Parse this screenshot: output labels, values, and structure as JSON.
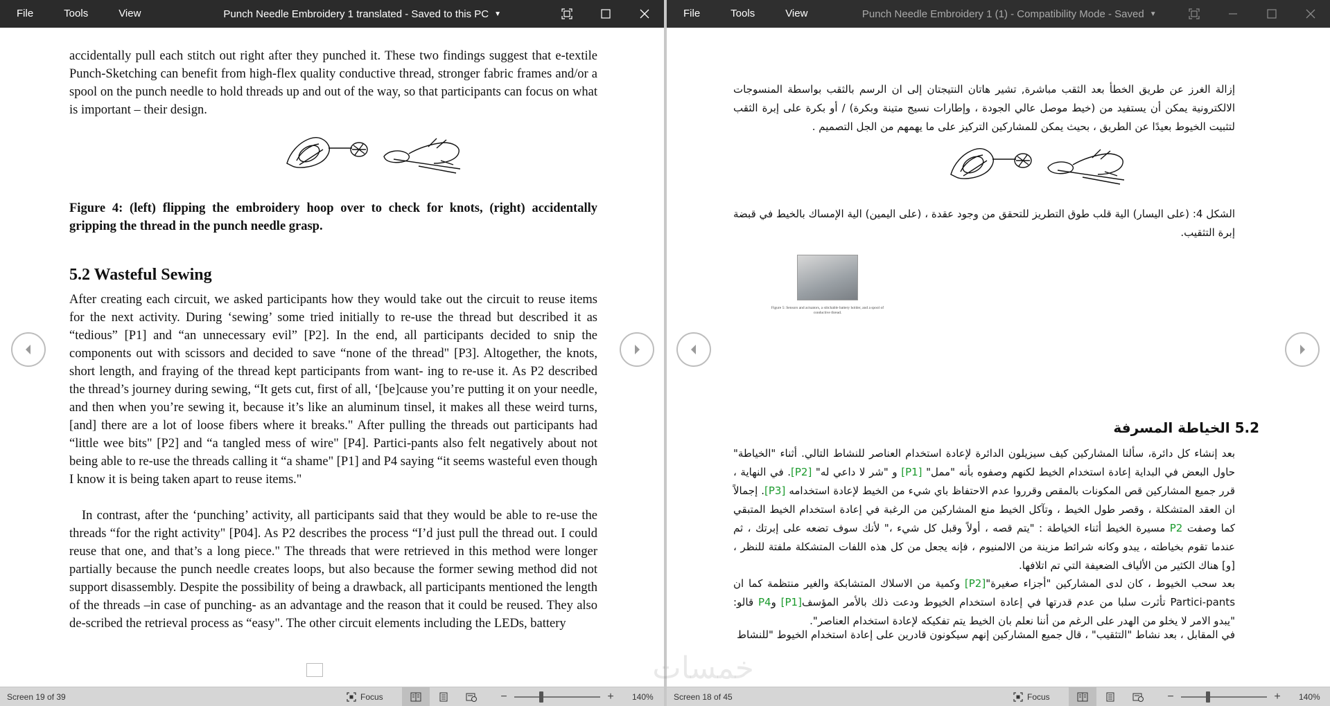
{
  "left_window": {
    "menu": [
      "File",
      "Tools",
      "View"
    ],
    "title": "Punch Needle Embroidery 1 translated  -  Saved to this PC",
    "status": {
      "screen": "Screen 19 of 39",
      "focus": "Focus",
      "zoom": "140%"
    },
    "doc": {
      "para1": "accidentally pull each stitch out right after they punched it. These two findings suggest that e-textile Punch-Sketching can benefit from high-flex quality conductive thread, stronger fabric frames and/or a spool on the punch needle to hold threads up and out of the way, so that participants can focus on what is important – their design.",
      "caption": "Figure 4: (left) flipping the embroidery hoop over to check for knots, (right) accidentally gripping the thread in the punch needle grasp.",
      "heading": "5.2 Wasteful Sewing",
      "para2": "After creating each circuit, we asked participants how they would take out the circuit to reuse items for the next activity. During ‘sewing’ some tried initially to re-use the thread but described it as “tedious” [P1] and “an unnecessary evil” [P2]. In the end, all participants decided to snip the components out with scissors and decided to save “none of the thread\" [P3]. Altogether, the knots, short length, and fraying of the thread kept participants from want- ing to re-use it. As P2 described the thread’s journey during sewing, “It gets cut, first of all, ‘[be]cause you’re putting it on your needle, and then when you’re sewing it, because it’s like an aluminum tinsel, it makes all these weird turns, [and] there are a lot of loose fibers where it breaks.\" After pulling the threads out participants had “little wee bits\" [P2] and “a tangled mess of wire\" [P4]. Partici-pants also felt negatively about not being able to re-use the threads calling it “a shame\" [P1] and P4 saying “it seems wasteful even though I know it is being taken apart to reuse items.\"",
      "para3": "In contrast, after the ‘punching’ activity, all participants said that they would be able to re-use the threads “for the right activity\" [P04]. As P2 describes the process “I’d just pull the thread out. I could reuse that one, and that’s a long piece.\" The threads that were retrieved in this method were longer partially because the punch needle creates loops, but also because the former sewing method did not support disassembly. Despite the possibility of being a drawback, all participants mentioned the length of the threads –in case of punching- as an advantage and the reason that it could be reused. They also de-scribed the retrieval process as “easy\". The other circuit elements including the LEDs, battery"
    }
  },
  "right_window": {
    "menu": [
      "File",
      "Tools",
      "View"
    ],
    "title": "Punch Needle Embroidery 1 (1)  -  Compatibility Mode  -  Saved",
    "status": {
      "screen": "Screen 18 of 45",
      "focus": "Focus",
      "zoom": "140%"
    },
    "doc": {
      "para1": "إزالة الغرز عن طريق الخطأ بعد الثقب مباشرة, تشير هاتان النتيجتان إلى ان الرسم بالثقب بواسطة المنسوجات الالكترونية يمكن أن يستفيد من (خيط موصل عالي الجودة ، وإطارات نسيج متينة وبكرة) / أو بكرة على إبرة الثقب لتثبيت الخيوط بعيدًا عن الطريق ، بحيث يمكن للمشاركين التركيز على ما يهمهم من الجل التصميم .",
      "caption": "الشكل 4: (على اليسار) الية قلب طوق التطريز للتحقق من وجود عقدة ، (على اليمين) الية الإمساك بالخيط في قبضة إبرة التثقيب.",
      "photo_caption": "Figure 5: Sensors and actuators, a stitchable battery holder, and a spool of conductive thread.",
      "heading": "5.2  الخياطة المسرفة",
      "para2_a": "بعد إنشاء كل دائرة، سألنا المشاركين كيف سيزيلون الدائرة لإعادة استخدام العناصر للنشاط التالي. أثناء \"الخياطة\" حاول البعض في البداية إعادة استخدام الخيط لكنهم وصفوه بأنه \"ممل\" ",
      "p1": "[P1]",
      "para2_b": " و \"شر لا داعي له\" ",
      "p2": "[P2]",
      "para2_c": ". في النهاية ، قرر جميع المشاركين قص المكونات بالمقص وقرروا عدم الاحتفاظ باي شيء من الخيط لإعادة استخدامه ",
      "p3": "[P3]",
      "para2_d": ". إجمالاً ان العقد المتشكلة ، وقصر طول الخيط ، وتآكل الخيط منع المشاركين من الرغبة في إعادة استخدام الخيط المتبقي كما وصفت ",
      "p2b": "P2",
      "para2_e": " مسيرة الخيط أثناء الخياطة : \"يتم قصه ، أولاً وقبل كل شيء ،\" لأنك سوف تضعه على إبرتك ، ثم عندما تقوم بخياطته ، يبدو وكانه شرائط مزينة من الالمنيوم ، فإنه يجعل من كل هذه اللفات المتشكلة ملفتة للنظر ، [و] هناك الكثير من الألياف الضعيفة التي تم اتلافها.",
      "para3_a": "بعد سحب الخيوط ، كان لدى المشاركين \"أجزاء صغيرة\"",
      "p2c": "[P2]",
      "para3_b": " وكمية من الاسلاك المتشابكة والغير منتظمة كما ان Partici-pants تأثرت سلبا من عدم قدرتها في إعادة استخدام الخيوط ودعت ذلك بالأمر المؤسف",
      "p1b": "[P1]",
      "para3_c": " و",
      "p4": "P4",
      "para3_d": " قالو: \"يبدو الامر لا يخلو من الهدر على الرغم من أننا نعلم بان الخيط يتم تفكيكه لإعادة استخدام العناصر\".",
      "para4": "في المقابل ، بعد نشاط \"التثقيب\" ، قال جميع المشاركين إنهم سيكونون قادرين على إعادة استخدام الخيوط \"للنشاط"
    }
  },
  "watermark": "خمسات",
  "colors": {
    "titlebar_left": "#2b2b2b",
    "titlebar_right": "#2f2f2f",
    "statusbar": "#d6d6d6",
    "citation_green": "#1a9a2c"
  },
  "icons": {
    "fullscreen": "fullscreen-icon",
    "maximize": "maximize-icon",
    "minimize": "minimize-icon",
    "close": "close-icon",
    "prev": "chevron-left-icon",
    "next": "chevron-right-icon",
    "focus": "focus-icon"
  }
}
